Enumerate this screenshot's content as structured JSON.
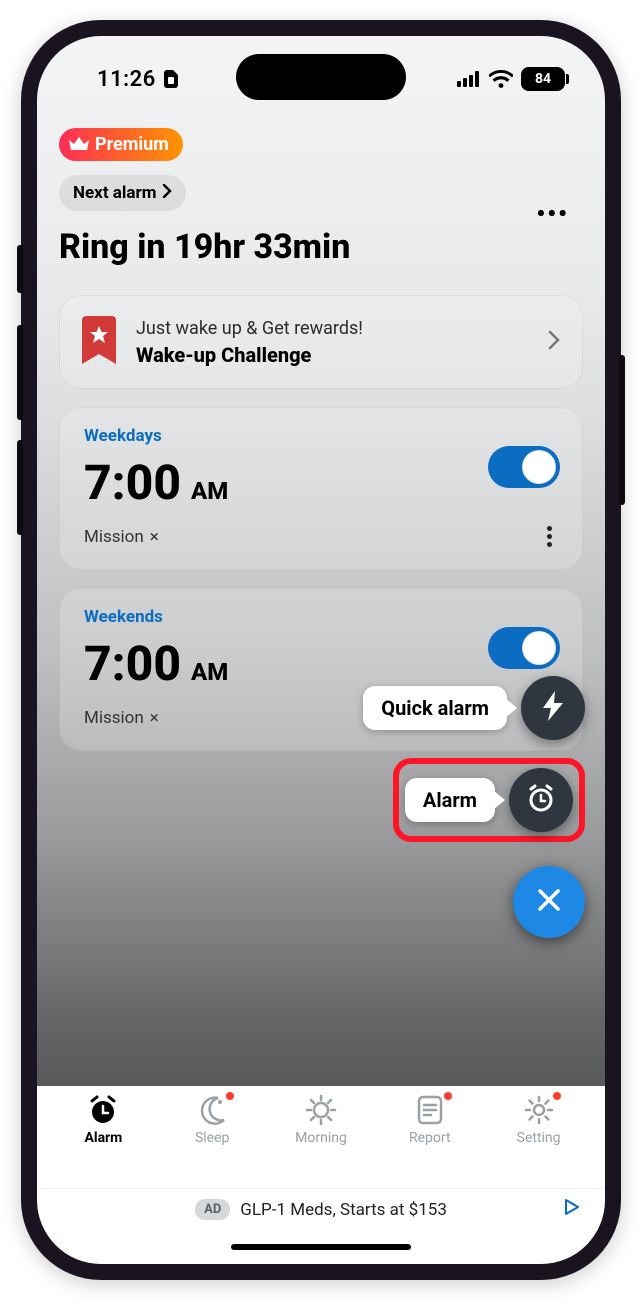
{
  "status": {
    "time": "11:26",
    "battery": "84"
  },
  "header": {
    "premium_label": "Premium",
    "next_alarm_label": "Next alarm",
    "ring_in": "Ring in 19hr 33min"
  },
  "challenge": {
    "line1": "Just wake up & Get rewards!",
    "line2": "Wake-up Challenge"
  },
  "alarms": [
    {
      "label": "Weekdays",
      "time": "7:00",
      "ampm": "AM",
      "mission": "Mission",
      "mission_icon": "×",
      "enabled": true
    },
    {
      "label": "Weekends",
      "time": "7:00",
      "ampm": "AM",
      "mission": "Mission",
      "mission_icon": "×",
      "enabled": true
    }
  ],
  "fab": {
    "quick_alarm_label": "Quick alarm",
    "alarm_label": "Alarm"
  },
  "tabs": {
    "alarm": "Alarm",
    "sleep": "Sleep",
    "morning": "Morning",
    "report": "Report",
    "setting": "Setting"
  },
  "ad": {
    "badge": "AD",
    "text": "GLP-1 Meds, Starts at $153"
  }
}
